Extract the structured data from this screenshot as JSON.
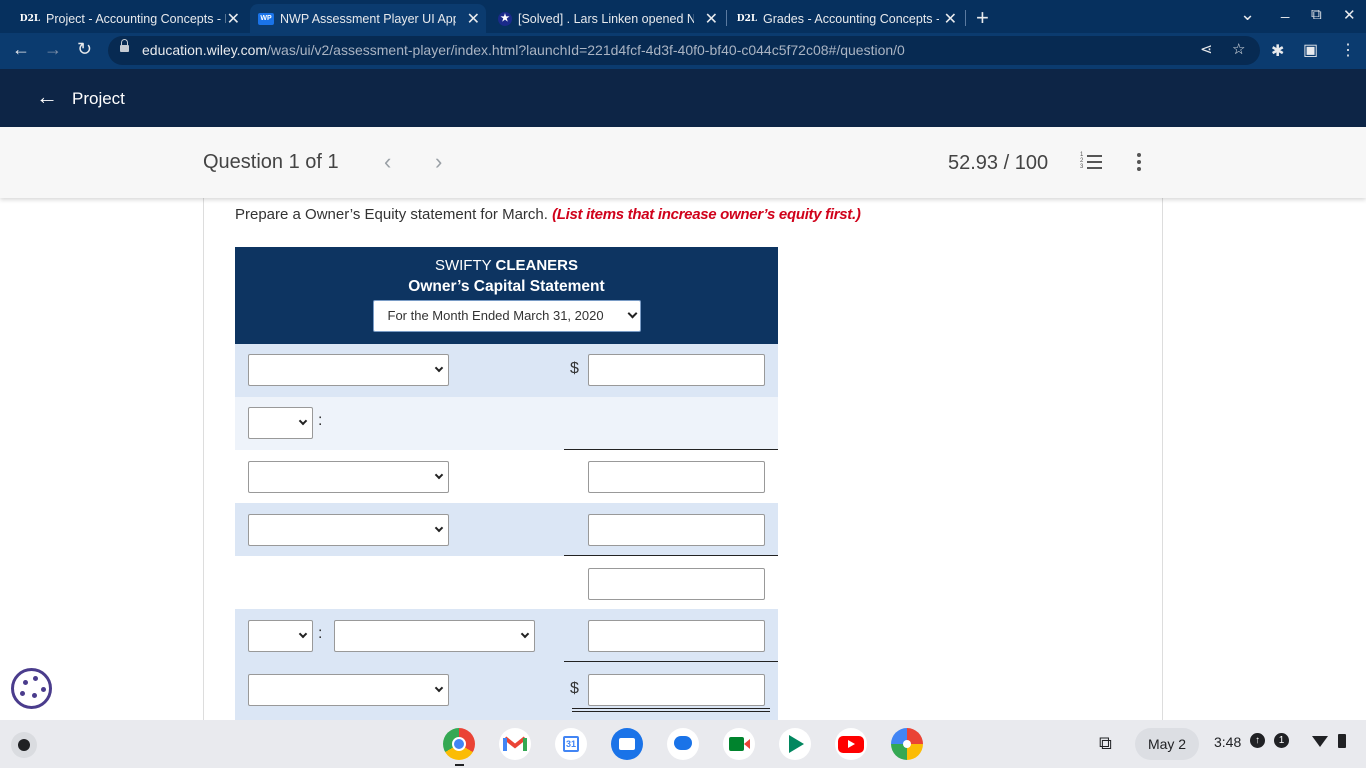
{
  "browser": {
    "tabs": [
      {
        "favicon": "D2L",
        "title": "Project - Accounting Concepts - I",
        "close": "✕"
      },
      {
        "favicon": "WP",
        "title": "NWP Assessment Player UI App",
        "close": "✕"
      },
      {
        "favicon": "★",
        "title": "[Solved] . Lars Linken opened No",
        "close": "✕"
      },
      {
        "favicon": "D2L",
        "title": "Grades - Accounting Concepts - I",
        "close": "✕"
      }
    ],
    "new_tab": "+",
    "window_controls": {
      "tab_search": "⌄",
      "minimize": "_",
      "restore": "⧉",
      "close": "✕"
    },
    "url_host": "education.wiley.com",
    "url_path": "/was/ui/v2/assessment-player/index.html?launchId=221d4fcf-4d3f-40f0-bf40-c044c5f72c08#/question/0",
    "nav": {
      "back": "←",
      "forward": "→",
      "reload": "↻"
    },
    "omnibox_icons": {
      "share": "⋖",
      "bookmark": "☆"
    },
    "toolbar_icons": {
      "extensions": "✱",
      "sidepanel": "▣",
      "menu": "⋮"
    }
  },
  "app_header": {
    "back_arrow": "←",
    "title": "Project"
  },
  "question_bar": {
    "label": "Question 1 of 1",
    "prev": "‹",
    "next": "›",
    "score": "52.93 / 100"
  },
  "instruction": {
    "text": "Prepare a Owner’s Equity statement for March.",
    "emphasis": "(List items that increase owner’s equity first.)"
  },
  "statement": {
    "company_plain": "SWIFTY",
    "company_bold": "CLEANERS",
    "title": "Owner’s Capital Statement",
    "period_selected": "For the Month Ended March 31, 2020",
    "dollar_sign": "$",
    "colon": ":"
  },
  "shelf": {
    "date": "May 2",
    "time": "3:48",
    "notification_count": "1",
    "calendar_day": "31"
  },
  "colors": {
    "tab_strip": "#06305e",
    "toolbar": "#0b3b6f",
    "app_header": "#0d2546",
    "statement_header": "#0d3461",
    "row_shade": "#dbe6f5",
    "row_light": "#eef3fa",
    "instruction_emphasis": "#d0021b"
  }
}
